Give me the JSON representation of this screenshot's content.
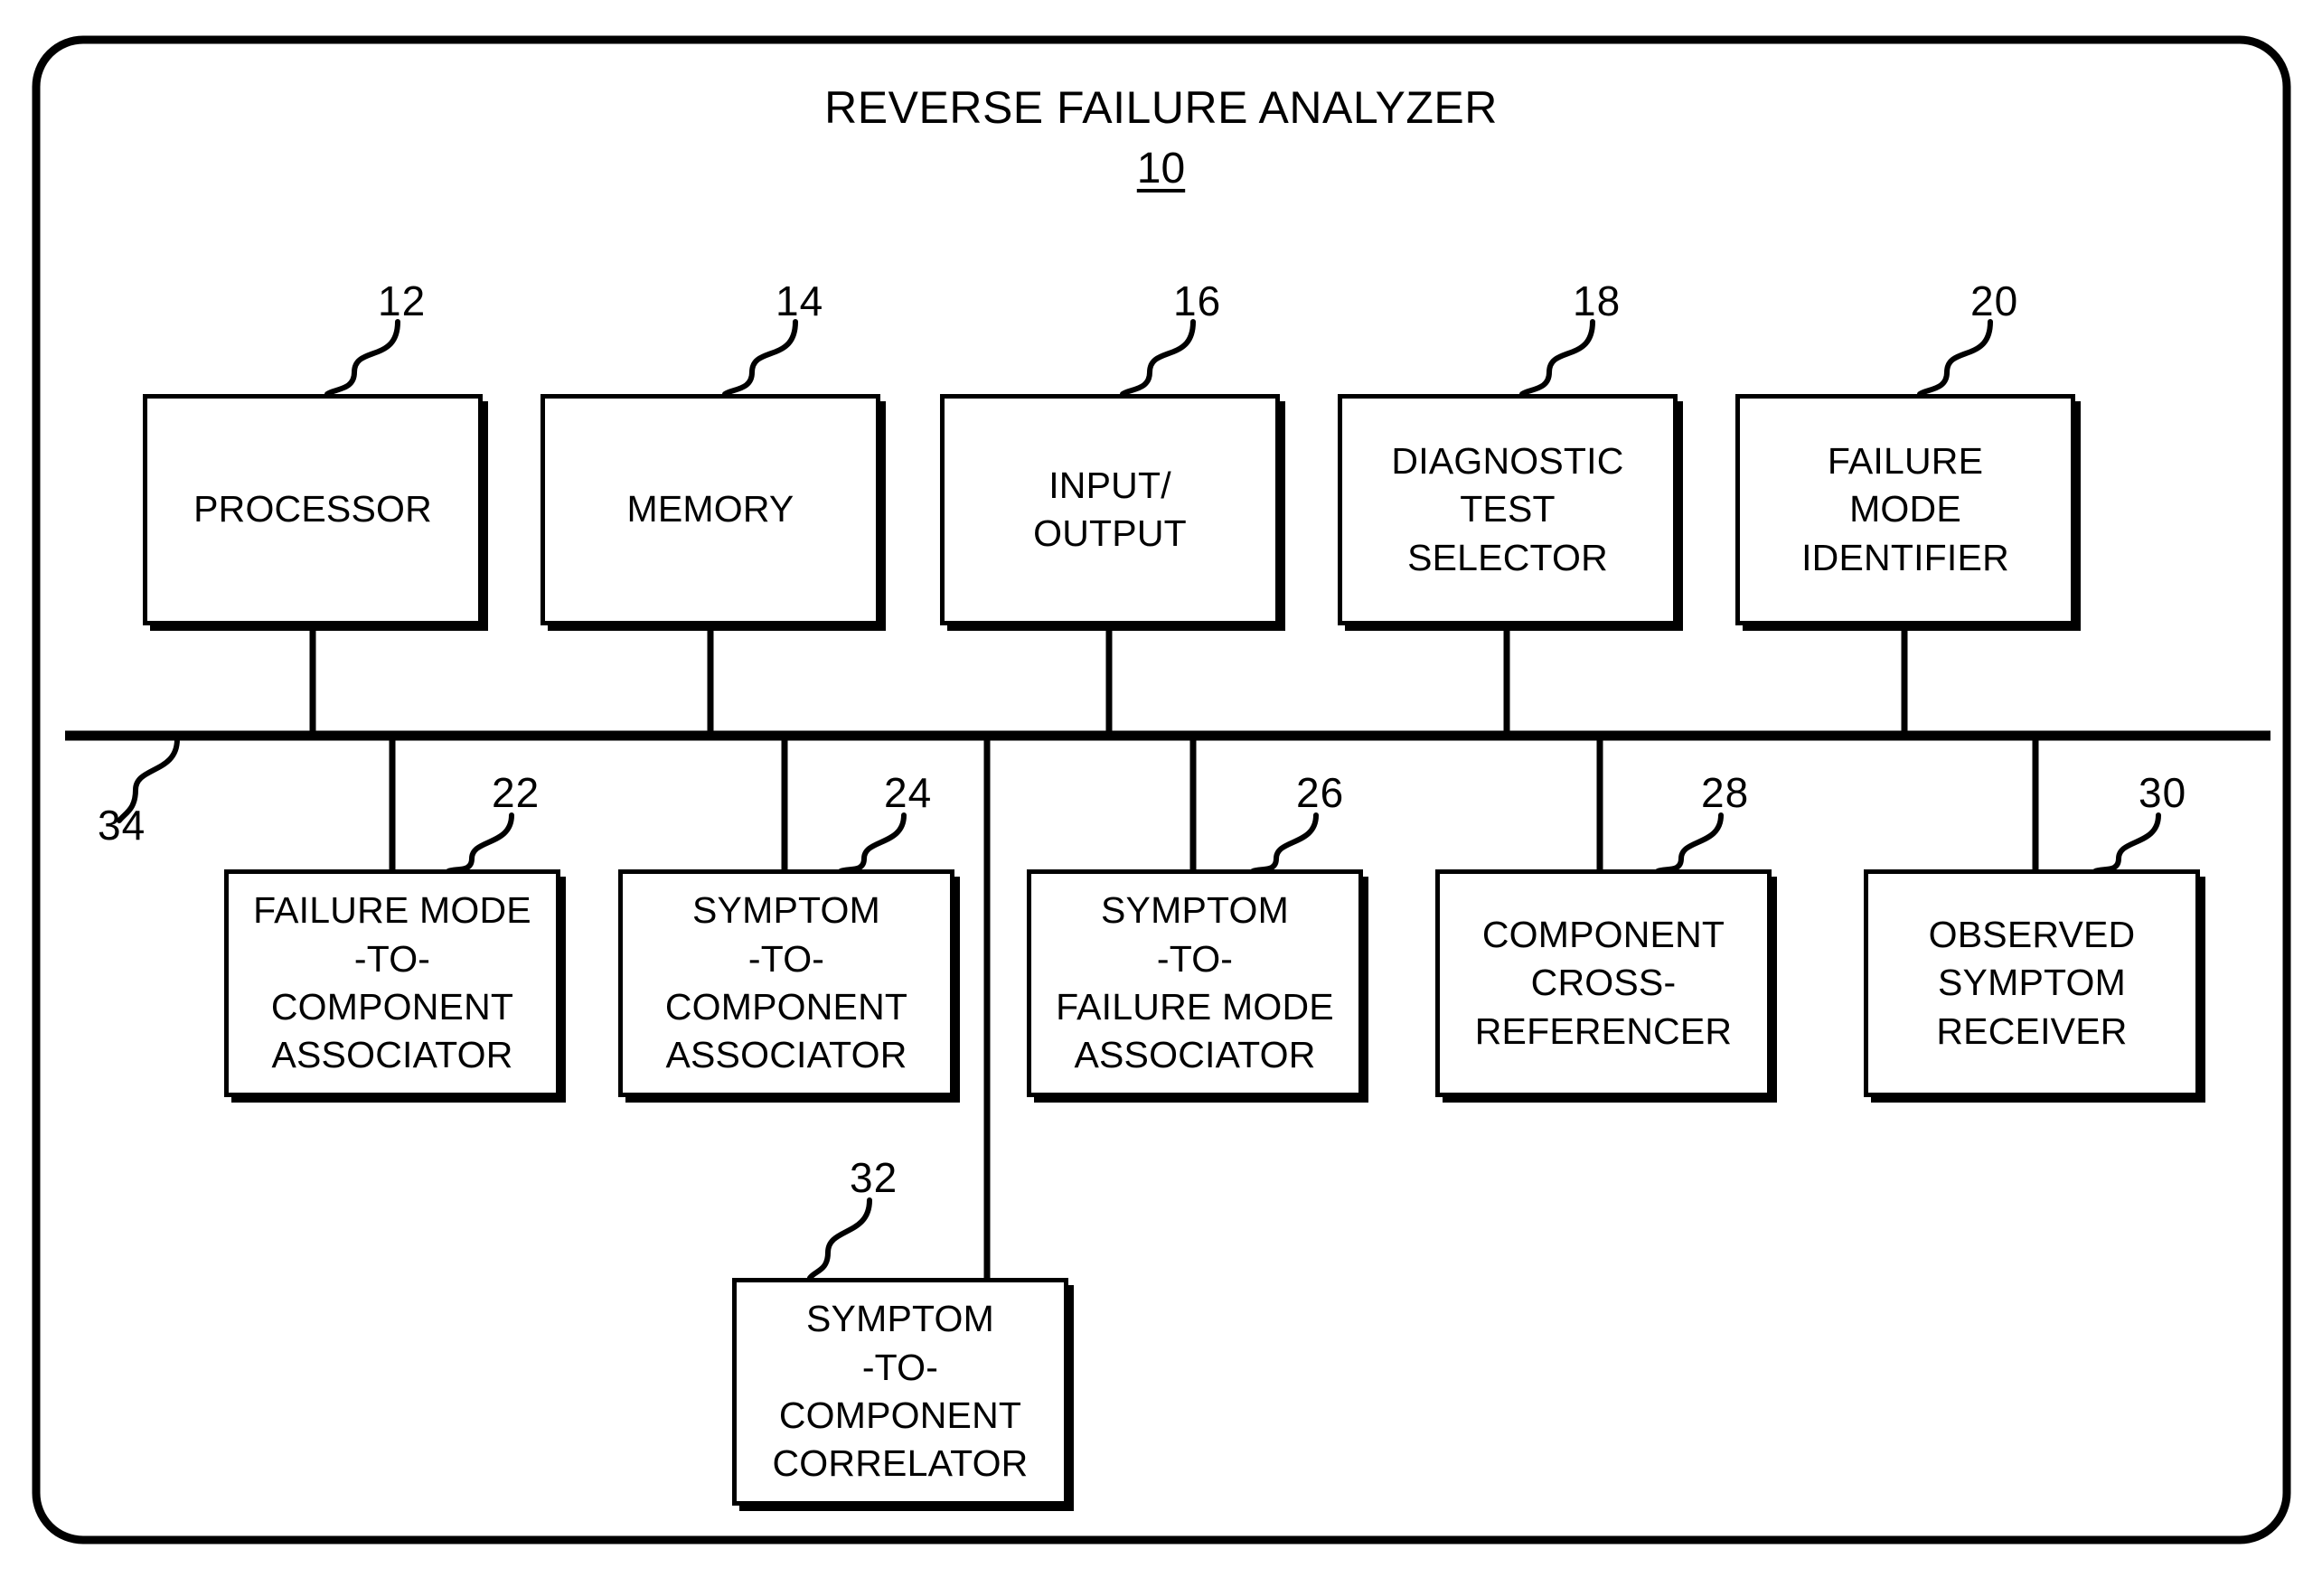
{
  "figure": {
    "title": "REVERSE FAILURE ANALYZER",
    "title_numeral": "10",
    "outer_shape": "rounded-rectangle",
    "line_color": "#000000",
    "background_color": "#ffffff"
  },
  "bus": {
    "numeral": "34",
    "name": "system-bus"
  },
  "top_row": [
    {
      "numeral": "12",
      "label": "PROCESSOR",
      "name": "processor"
    },
    {
      "numeral": "14",
      "label": "MEMORY",
      "name": "memory"
    },
    {
      "numeral": "16",
      "label": "INPUT/\nOUTPUT",
      "name": "input-output"
    },
    {
      "numeral": "18",
      "label": "DIAGNOSTIC\nTEST\nSELECTOR",
      "name": "diagnostic-test-selector"
    },
    {
      "numeral": "20",
      "label": "FAILURE\nMODE\nIDENTIFIER",
      "name": "failure-mode-identifier"
    }
  ],
  "bottom_row": [
    {
      "numeral": "22",
      "label": "FAILURE MODE\n-TO-\nCOMPONENT\nASSOCIATOR",
      "name": "failure-mode-to-component-associator"
    },
    {
      "numeral": "24",
      "label": "SYMPTOM\n-TO-\nCOMPONENT\nASSOCIATOR",
      "name": "symptom-to-component-associator"
    },
    {
      "numeral": "26",
      "label": "SYMPTOM\n-TO-\nFAILURE MODE\nASSOCIATOR",
      "name": "symptom-to-failure-mode-associator"
    },
    {
      "numeral": "28",
      "label": "COMPONENT\nCROSS-\nREFERENCER",
      "name": "component-cross-referencer"
    },
    {
      "numeral": "30",
      "label": "OBSERVED\nSYMPTOM\nRECEIVER",
      "name": "observed-symptom-receiver"
    }
  ],
  "lower_block": {
    "numeral": "32",
    "label": "SYMPTOM\n-TO-\nCOMPONENT\nCORRELATOR",
    "name": "symptom-to-component-correlator"
  }
}
